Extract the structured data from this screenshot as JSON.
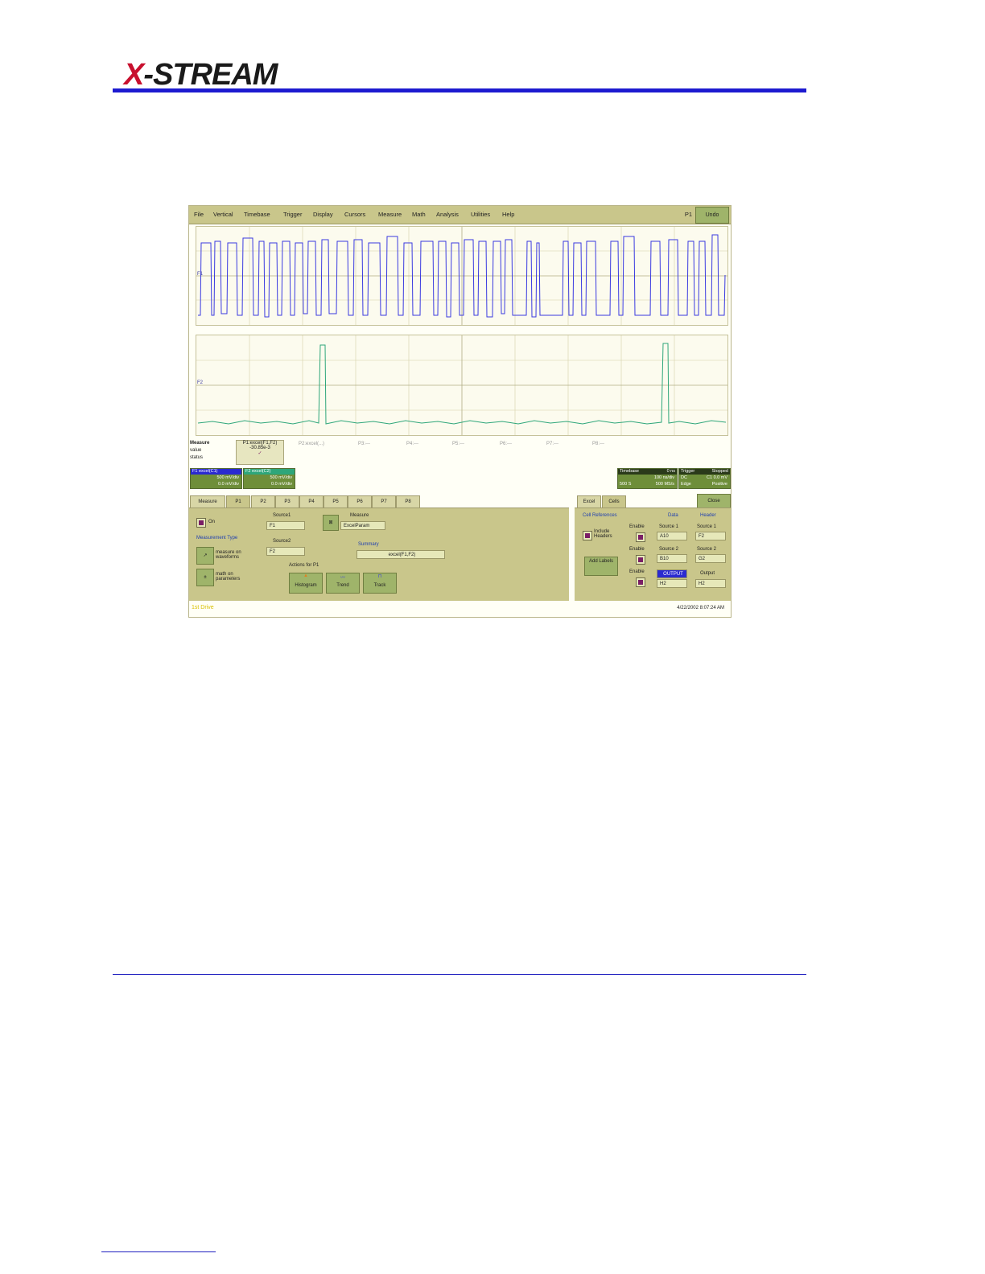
{
  "header": {
    "logo_x": "X",
    "logo_rest": "-STREAM"
  },
  "menu": {
    "items": [
      "File",
      "Vertical",
      "Timebase",
      "Trigger",
      "Display",
      "Cursors",
      "Measure",
      "Math",
      "Analysis",
      "Utilities",
      "Help"
    ],
    "p1": "P1",
    "undo": "Undo"
  },
  "measure_strip": {
    "title": "Measure",
    "row_value": "value",
    "row_status": "status",
    "p1_header": "P1:excel(F1,F2)",
    "p1_value": "-30.85e-3",
    "p1_check": "✓",
    "others": [
      "P2:excel(...)",
      "P3:---",
      "P4:---",
      "P5:---",
      "P6:---",
      "P7:---",
      "P8:---"
    ]
  },
  "channels": {
    "f1": {
      "name": "F1",
      "desc": "excel(C1)",
      "scale": "500 mV/div",
      "offset": "0.0 mV/div"
    },
    "f2": {
      "name": "F2",
      "desc": "excel(C2)",
      "scale": "500 mV/div",
      "offset": "0.0 mV/div"
    },
    "timebase": {
      "title": "Timebase",
      "val1": "0 ns",
      "val2": "100 ns/div",
      "val3": "500 S",
      "val4": "500 MS/s"
    },
    "trigger": {
      "title": "Trigger",
      "state": "Stopped",
      "line1": "DC",
      "line1b": "C1 0.0 mV",
      "line2": "Edge",
      "line2b": "Positive"
    }
  },
  "tabs_left": [
    "Measure",
    "P1",
    "P2",
    "P3",
    "P4",
    "P5",
    "P6",
    "P7",
    "P8"
  ],
  "tabs_right": [
    "Excel",
    "Cells"
  ],
  "close": "Close",
  "p1_panel": {
    "on_label": "On",
    "source1_label": "Source1",
    "source1_value": "F1",
    "source2_label": "Source2",
    "source2_value": "F2",
    "measure_label": "Measure",
    "measure_value": "ExcelParam",
    "summary_label": "Summary",
    "summary_value": "excel(F1,F2)",
    "type_label": "Measurement Type",
    "type_wave": "measure on waveforms",
    "type_param": "math on parameters",
    "actions_label": "Actions for P1",
    "actions": [
      "Histogram",
      "Trend",
      "Track"
    ]
  },
  "cells_panel": {
    "cell_refs": "Cell References",
    "include_headers": "Include Headers",
    "add_labels": "Add Labels",
    "data_label": "Data",
    "header_label": "Header",
    "enable": "Enable",
    "rows": [
      {
        "src_label": "Source 1",
        "data": "A10",
        "hdr_label": "Source 1",
        "hdr": "F2"
      },
      {
        "src_label": "Source 2",
        "data": "B10",
        "hdr_label": "Source 2",
        "hdr": "G2"
      },
      {
        "src_label": "OUTPUT",
        "data": "H2",
        "hdr_label": "Output",
        "hdr": "H2"
      }
    ]
  },
  "status": {
    "left": "1st Drive",
    "right": "4/22/2002 8:07:24 AM"
  },
  "colors": {
    "trace1": "#3a3ae0",
    "trace2": "#2ea67a",
    "menubar": "#c9c68b",
    "rule": "#1d1ad0"
  }
}
